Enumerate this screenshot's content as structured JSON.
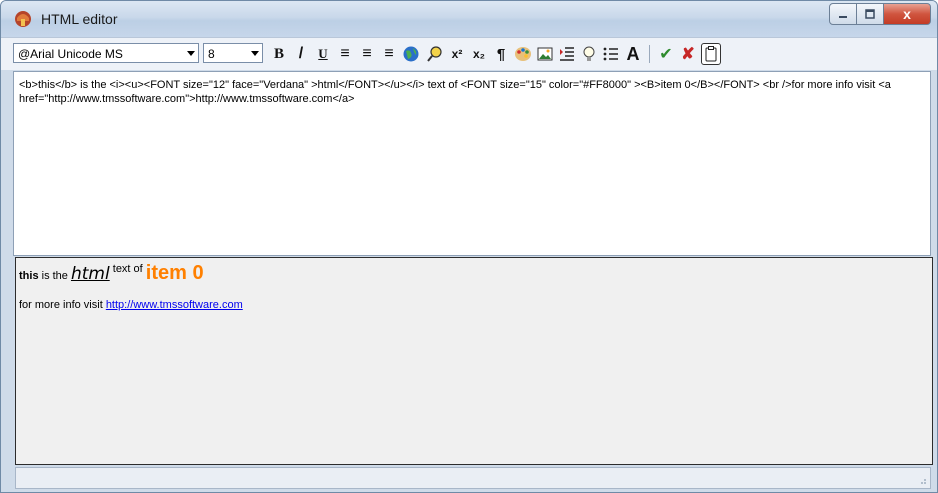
{
  "window": {
    "title": "HTML editor",
    "controls": {
      "minimize_icon": "minimize-icon",
      "maximize_icon": "maximize-icon",
      "close_label": "x"
    }
  },
  "toolbar": {
    "font_name": "@Arial Unicode MS",
    "font_size": "8",
    "buttons": [
      {
        "name": "bold-button",
        "label": "B"
      },
      {
        "name": "italic-button",
        "label": "/"
      },
      {
        "name": "underline-button",
        "label": "U"
      },
      {
        "name": "align-left-button",
        "label": "≡"
      },
      {
        "name": "align-center-button",
        "label": "≡"
      },
      {
        "name": "align-right-button",
        "label": "≡"
      },
      {
        "name": "hyperlink-button",
        "label": "🌐"
      },
      {
        "name": "find-button",
        "label": "⌕"
      },
      {
        "name": "superscript-button",
        "label": "x²"
      },
      {
        "name": "subscript-button",
        "label": "x₂"
      },
      {
        "name": "paragraph-button",
        "label": "¶"
      },
      {
        "name": "color-palette-button",
        "label": "🎨"
      },
      {
        "name": "insert-image-button",
        "label": "🖼"
      },
      {
        "name": "indent-button",
        "label": "⇥"
      },
      {
        "name": "hint-button",
        "label": "💡"
      },
      {
        "name": "bullet-list-button",
        "label": "☰"
      },
      {
        "name": "font-button",
        "label": "A"
      },
      {
        "name": "ok-button",
        "label": "✔"
      },
      {
        "name": "cancel-button",
        "label": "✘"
      },
      {
        "name": "paste-button",
        "label": "📋"
      }
    ]
  },
  "editor": {
    "source_text": "<b>this</b> is the <i><u><FONT  size=\"12\" face=\"Verdana\" >html</FONT></u></i> text of <FONT  size=\"15\" color=\"#FF8000\" ><B>item 0</B></FONT> <br />for more info visit <a href=\"http://www.tmssoftware.com\">http://www.tmssoftware.com</a>"
  },
  "preview": {
    "bold_word": "this",
    "text_a": " is the ",
    "italic_word": "html",
    "text_b": " text of ",
    "item_text": "item 0",
    "item_color": "#FF8000",
    "line2_prefix": "for more info visit ",
    "link_text": "http://www.tmssoftware.com"
  }
}
